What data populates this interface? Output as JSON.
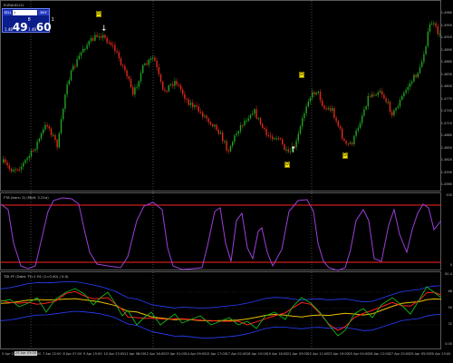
{
  "chart": {
    "symbol": "EURAUD,H1",
    "sell_label": "SELL",
    "lot_value": "1",
    "buy_label": "BUY",
    "sell_price_small": "1.48",
    "sell_price_big": "49",
    "sell_price_sup": "8",
    "buy_price_small": "1.48",
    "buy_price_big": "60",
    "buy_price_sup": "1",
    "price_axis": [
      "1.4980",
      "1.4950",
      "1.4920",
      "1.4890",
      "1.4860",
      "1.4830",
      "1.4800",
      "1.4770",
      "1.4740",
      "1.4710",
      "1.4680",
      "1.4650",
      "1.4620",
      "1.4590",
      "1.4560"
    ],
    "markers": [
      {
        "label": "D"
      },
      {
        "label": "D"
      },
      {
        "label": "D"
      },
      {
        "label": "D"
      }
    ]
  },
  "osc": {
    "title": "FTA (bars: 2) (Mult: 2.21a)",
    "axis": [
      "100",
      "0"
    ]
  },
  "tdi": {
    "title": "TDI-FF (Data: Tf=1 H1 (1=0.40) / 0.0)",
    "axis": [
      "81.4",
      "68",
      "50",
      "32",
      "0.00"
    ]
  },
  "time_axis": {
    "highlight": "26 Apr 03:00",
    "labels": [
      "5 Apr 2019",
      "6 Apr 14:00",
      "7 Apr 22:00",
      "8 Apr 07:00",
      "9 Apr 15:00",
      "10 Apr 23:00",
      "11 Apr 08:00",
      "12 Apr 16:00",
      "13 Apr 01:00",
      "14 Apr 09:00",
      "15 Apr 17:00",
      "17 Apr 02:00",
      "18 Apr 10:00",
      "19 Apr 18:00",
      "21 Apr 03:00",
      "22 Apr 11:00",
      "23 Apr 19:00",
      "25 Apr 04:00",
      "26 Apr 12:00",
      "27 Apr 20:00",
      "29 Apr 05:00",
      "30 Apr 13:00"
    ]
  },
  "colors": {
    "bull": "#22a322",
    "bear": "#e12a1a",
    "osc_line": "#9c3fd8",
    "osc_band": "#ff2222",
    "tdi_price": "#16b516",
    "tdi_signal": "#ff2020",
    "tdi_mid": "#e8c000",
    "tdi_band": "#2a3fff",
    "separator": "#7a7a7a"
  }
}
